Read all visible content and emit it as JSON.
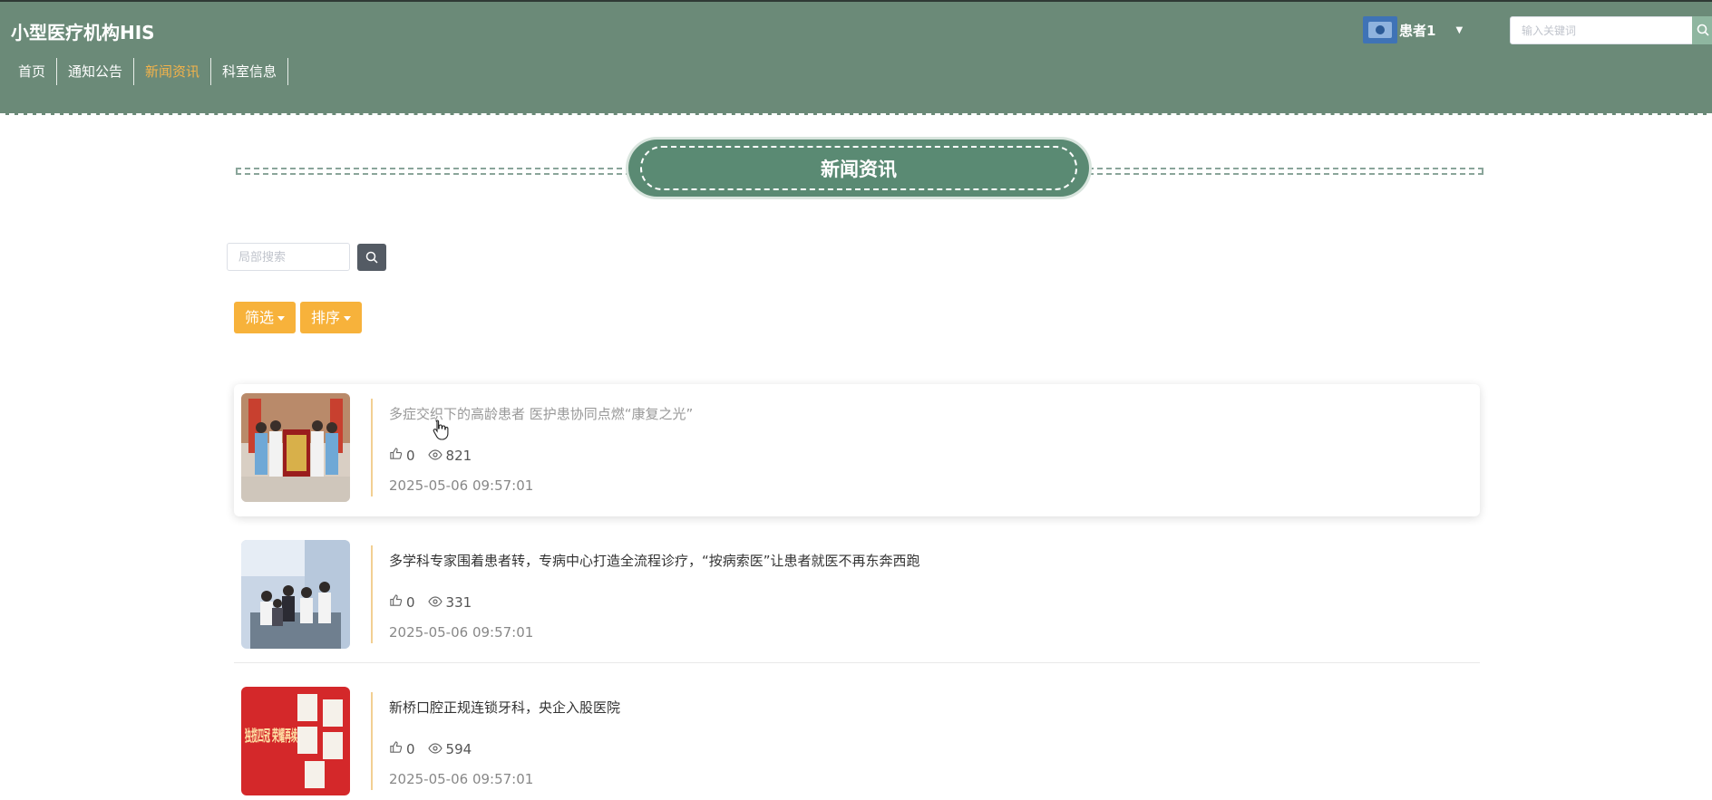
{
  "header": {
    "app_title": "小型医疗机构HIS",
    "nav": [
      {
        "label": "首页",
        "active": false
      },
      {
        "label": "通知公告",
        "active": false
      },
      {
        "label": "新闻资讯",
        "active": true
      },
      {
        "label": "科室信息",
        "active": false
      }
    ],
    "user": {
      "name": "患者1",
      "avatar_icon": "avatar-image"
    },
    "search": {
      "placeholder": "输入关键词",
      "icon": "search-icon"
    }
  },
  "section": {
    "title": "新闻资讯"
  },
  "local_search": {
    "placeholder": "局部搜索",
    "icon": "search-icon"
  },
  "filters": {
    "filter_label": "筛选",
    "sort_label": "排序"
  },
  "news": [
    {
      "title": "多症交织下的高龄患者 医护患协同点燃“康复之光”",
      "likes": "0",
      "views": "821",
      "time": "2025-05-06 09:57:01",
      "image": "medical-team-banner-photo"
    },
    {
      "title": "多学科专家围着患者转，专病中心打造全流程诊疗，“按病索医”让患者就医不再东奔西跑",
      "likes": "0",
      "views": "331",
      "time": "2025-05-06 09:57:01",
      "image": "doctors-consultation-photo"
    },
    {
      "title": "新桥口腔正规连锁牙科，央企入股医院",
      "likes": "0",
      "views": "594",
      "time": "2025-05-06 09:57:01",
      "image": "award-red-poster",
      "image_text": "独揽四冠 荣耀再续"
    }
  ],
  "colors": {
    "header_bg": "#6b8a78",
    "accent": "#f7b23b",
    "active_nav": "#f4b34a",
    "title_pill": "#5a8a73"
  }
}
